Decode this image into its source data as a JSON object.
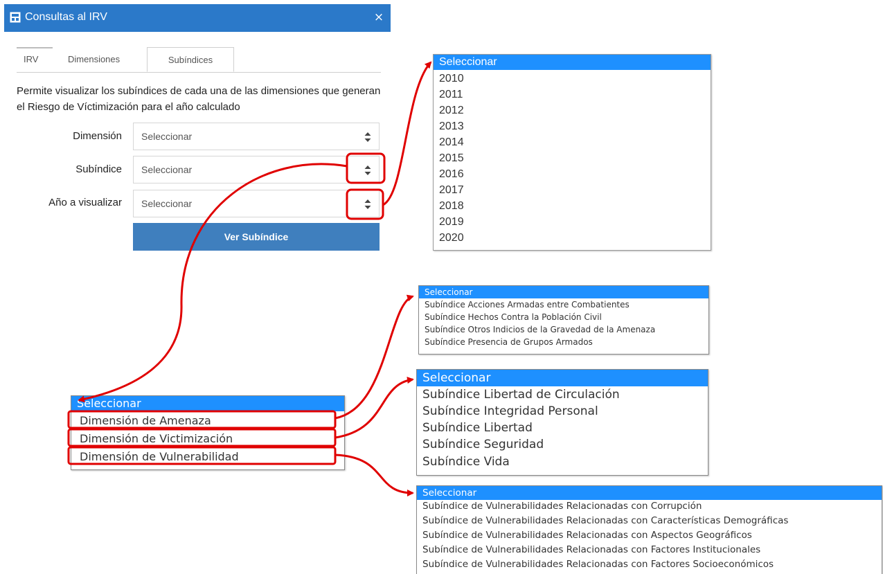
{
  "window": {
    "title": "Consultas al IRV",
    "close_glyph": "×"
  },
  "tabs": [
    {
      "label": "IRV"
    },
    {
      "label": "Dimensiones"
    },
    {
      "label": "Subíndices"
    }
  ],
  "description": "Permite visualizar los subíndices de cada una de las dimensiones que generan el Riesgo de Víctimización para el año calculado",
  "form": {
    "dimension": {
      "label": "Dimensión",
      "value": "Seleccionar"
    },
    "subindice": {
      "label": "Subíndice",
      "value": "Seleccionar"
    },
    "anio": {
      "label": "Año a visualizar",
      "value": "Seleccionar"
    },
    "submit_label": "Ver Subíndice"
  },
  "year_list": {
    "selected": "Seleccionar",
    "options": [
      "2010",
      "2011",
      "2012",
      "2013",
      "2014",
      "2015",
      "2016",
      "2017",
      "2018",
      "2019",
      "2020"
    ]
  },
  "dimension_list": {
    "selected": "Seleccionar",
    "options": [
      "Dimensión de Amenaza",
      "Dimensión de Victimización",
      "Dimensión de Vulnerabilidad"
    ]
  },
  "amenaza_subindices": {
    "selected": "Seleccionar",
    "options": [
      "Subíndice Acciones Armadas entre Combatientes",
      "Subíndice Hechos Contra la Población Civil",
      "Subíndice Otros Indicios de la Gravedad de la Amenaza",
      "Subíndice Presencia de Grupos Armados"
    ]
  },
  "victimizacion_subindices": {
    "selected": "Seleccionar",
    "options": [
      "Subíndice Libertad de Circulación",
      "Subíndice Integridad Personal",
      "Subíndice Libertad",
      "Subíndice Seguridad",
      "Subíndice Vida"
    ]
  },
  "vulnerabilidad_subindices": {
    "selected": "Seleccionar",
    "options": [
      "Subíndice de Vulnerabilidades Relacionadas con Corrupción",
      "Subíndice de Vulnerabilidades Relacionadas con Características Demográficas",
      "Subíndice de Vulnerabilidades Relacionadas con Aspectos Geográficos",
      "Subíndice de Vulnerabilidades Relacionadas con Factores Institucionales",
      "Subíndice de Vulnerabilidades Relacionadas con Factores Socioeconómicos"
    ]
  },
  "colors": {
    "titlebar": "#2b79c9",
    "button": "#3f7fbe",
    "highlight": "#1e90ff",
    "annotation": "#e00000"
  }
}
